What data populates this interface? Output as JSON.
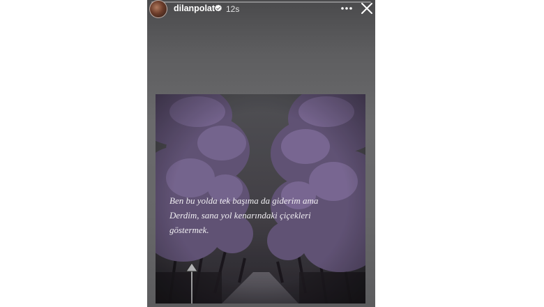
{
  "story": {
    "username": "dilanpolat",
    "time_ago": "12s",
    "progress": 0
  },
  "icons": {
    "verified": "verified-badge-icon",
    "more": "more-options-icon",
    "close": "close-icon"
  },
  "post": {
    "quote_lines": [
      "Ben bu yolda tek başıma da giderim ama",
      "Derdim, sana yol kenarındaki çiçekleri",
      "göstermek."
    ]
  },
  "colors": {
    "accent_blue": "#3897f0",
    "blossom": "#8a76a6"
  }
}
